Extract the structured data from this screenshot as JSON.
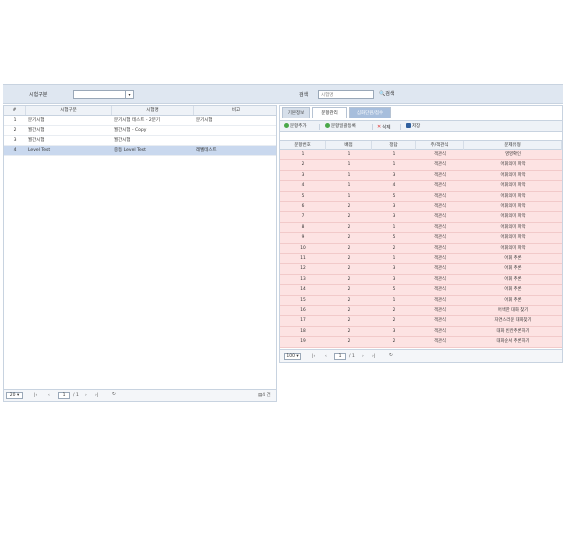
{
  "filter": {
    "exam_type_label": "시험구분",
    "exam_type_value": "",
    "search_label": "검색",
    "search_placeholder": "시험명",
    "search_button": "검색"
  },
  "left_grid": {
    "columns": [
      "#",
      "시험구분",
      "시험명",
      "비고"
    ],
    "rows": [
      {
        "no": "1",
        "type": "분기시험",
        "name": "분기시험 테스트 - 2분기",
        "note": "분기시험"
      },
      {
        "no": "2",
        "type": "월간시험",
        "name": "월간시험 - Copy",
        "note": ""
      },
      {
        "no": "3",
        "type": "월간시험",
        "name": "월간시험",
        "note": ""
      },
      {
        "no": "4",
        "type": "Level Test",
        "name": "중등 Level Test",
        "note": "레벨테스트"
      }
    ],
    "selected_row": 4,
    "pager": {
      "page_size": "20",
      "page": "1",
      "total_pages": "/ 1",
      "total_count": "4 건"
    }
  },
  "tabs": [
    "기본정보",
    "문항관리",
    "심화단원/점수"
  ],
  "active_tab": 1,
  "toolbar": {
    "add": "문항추가",
    "bulk_add": "문항일괄등록",
    "delete": "삭제",
    "save": "저장"
  },
  "right_grid": {
    "columns": [
      "문항번호",
      "배점",
      "정답",
      "주/객관식",
      "문제유형"
    ],
    "rows": [
      [
        "1",
        "1",
        "1",
        "객관식",
        "영영확인"
      ],
      [
        "2",
        "1",
        "1",
        "객관식",
        "어휘의미 파악"
      ],
      [
        "3",
        "1",
        "3",
        "객관식",
        "어휘의미 파악"
      ],
      [
        "4",
        "1",
        "4",
        "객관식",
        "어휘의미 파악"
      ],
      [
        "5",
        "1",
        "5",
        "객관식",
        "어휘의미 파악"
      ],
      [
        "6",
        "2",
        "3",
        "객관식",
        "어휘의미 파악"
      ],
      [
        "7",
        "2",
        "3",
        "객관식",
        "어휘의미 파악"
      ],
      [
        "8",
        "2",
        "1",
        "객관식",
        "어휘의미 파악"
      ],
      [
        "9",
        "2",
        "5",
        "객관식",
        "어휘의미 파악"
      ],
      [
        "10",
        "2",
        "2",
        "객관식",
        "어휘의미 파악"
      ],
      [
        "11",
        "2",
        "1",
        "객관식",
        "어휘 추론"
      ],
      [
        "12",
        "2",
        "3",
        "객관식",
        "어휘 추론"
      ],
      [
        "13",
        "2",
        "3",
        "객관식",
        "어휘 추론"
      ],
      [
        "14",
        "2",
        "5",
        "객관식",
        "어휘 추론"
      ],
      [
        "15",
        "2",
        "1",
        "객관식",
        "어휘 추론"
      ],
      [
        "16",
        "2",
        "2",
        "객관식",
        "어색한 대화 찾기"
      ],
      [
        "17",
        "2",
        "2",
        "객관식",
        "자연스러운 대화찾기"
      ],
      [
        "18",
        "2",
        "3",
        "객관식",
        "대화 빈칸추론하기"
      ],
      [
        "19",
        "2",
        "2",
        "객관식",
        "대화순서 추론하기"
      ]
    ],
    "pager": {
      "page_size": "100",
      "page": "1",
      "total_pages": "/ 1"
    }
  },
  "colors": {
    "row_highlight": "#fde3e3",
    "selected_row": "#c9d8ee",
    "header_bg": "#dfe7f1"
  }
}
